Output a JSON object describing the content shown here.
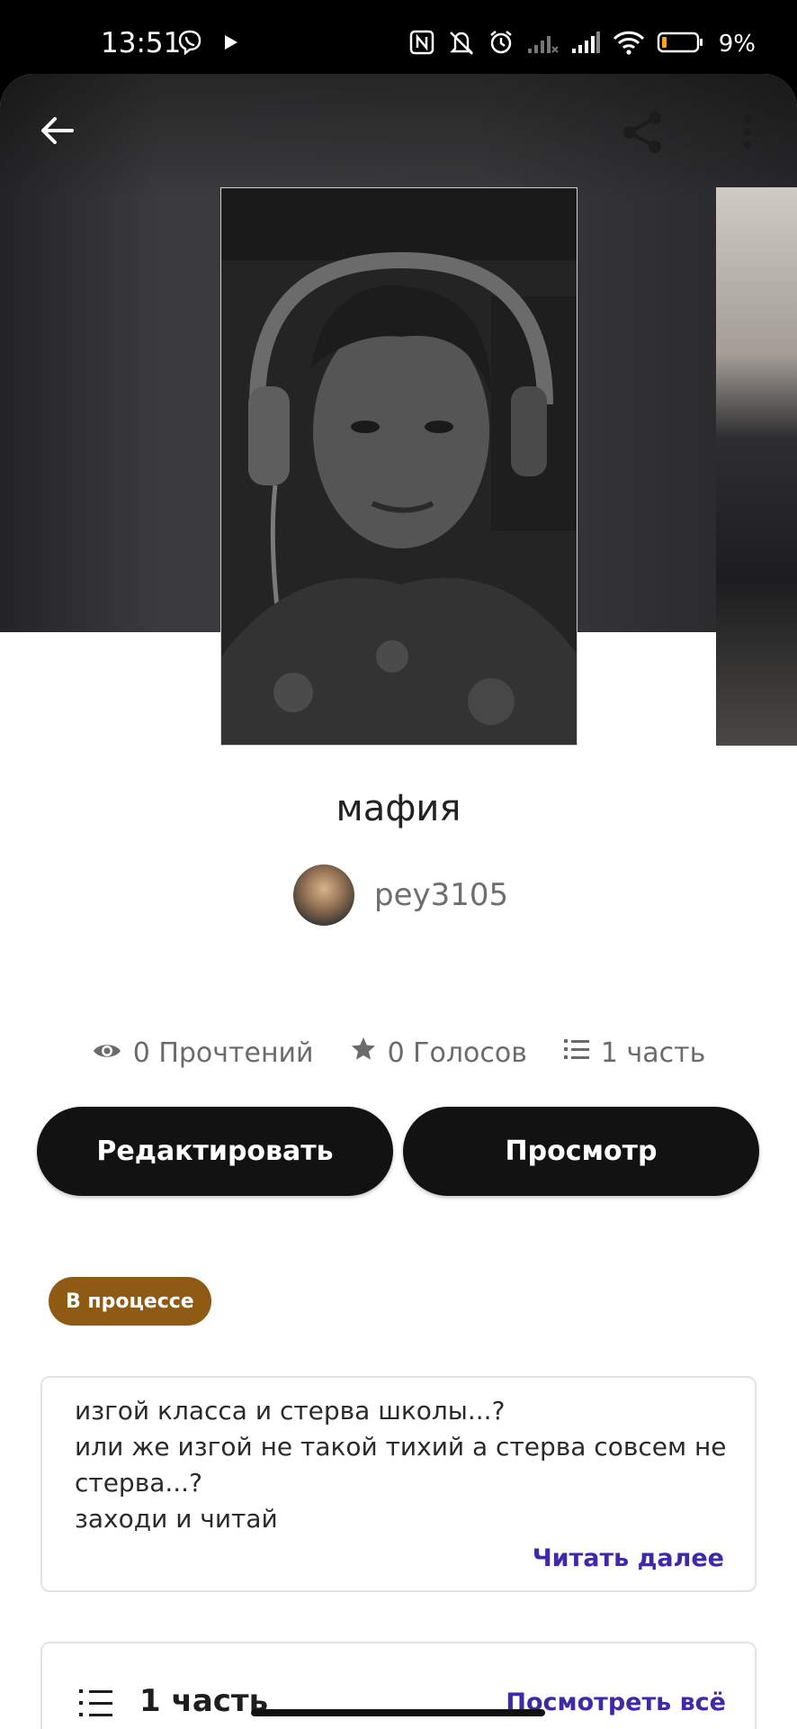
{
  "status_bar": {
    "time": "13:51",
    "battery": "9%"
  },
  "story": {
    "title": "мафия",
    "author": "pey3105",
    "status_badge": "В процессе"
  },
  "stats": {
    "reads": "0 Прочтений",
    "votes": "0 Голосов",
    "parts": "1 часть"
  },
  "actions": {
    "edit": "Редактировать",
    "view": "Просмотр"
  },
  "description": {
    "lines": [
      "изгой класса и стерва школы...?",
      "или же изгой не такой тихий а стерва совсем не",
      "стерва...?",
      "заходи и читай"
    ],
    "read_more": "Читать далее"
  },
  "parts_section": {
    "label": "1 часть",
    "see_all": "Посмотреть всё"
  },
  "colors": {
    "badge": "#8e5a14",
    "link": "#3c2aa8",
    "button": "#121212"
  },
  "icons": [
    "back-arrow-icon",
    "share-icon",
    "more-vert-icon",
    "eye-icon",
    "star-icon",
    "list-icon"
  ]
}
